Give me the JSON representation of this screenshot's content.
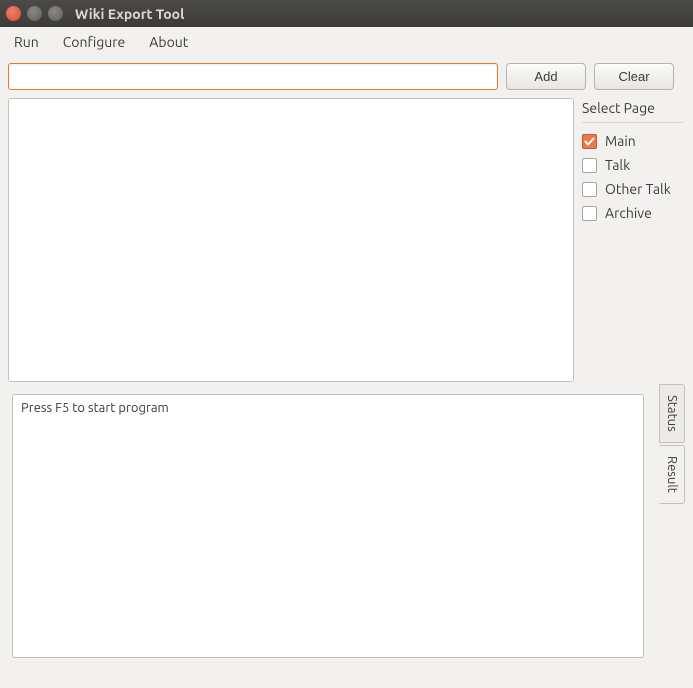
{
  "window": {
    "title": "Wiki Export Tool"
  },
  "menu": {
    "run": "Run",
    "configure": "Configure",
    "about": "About"
  },
  "toolbar": {
    "input_value": "",
    "add_label": "Add",
    "clear_label": "Clear"
  },
  "side": {
    "heading": "Select Page",
    "items": [
      {
        "label": "Main",
        "checked": true
      },
      {
        "label": "Talk",
        "checked": false
      },
      {
        "label": "Other Talk",
        "checked": false
      },
      {
        "label": "Archive",
        "checked": false
      }
    ]
  },
  "output": {
    "text": "Press F5 to start program"
  },
  "tabs": {
    "status": "Status",
    "result": "Result"
  }
}
